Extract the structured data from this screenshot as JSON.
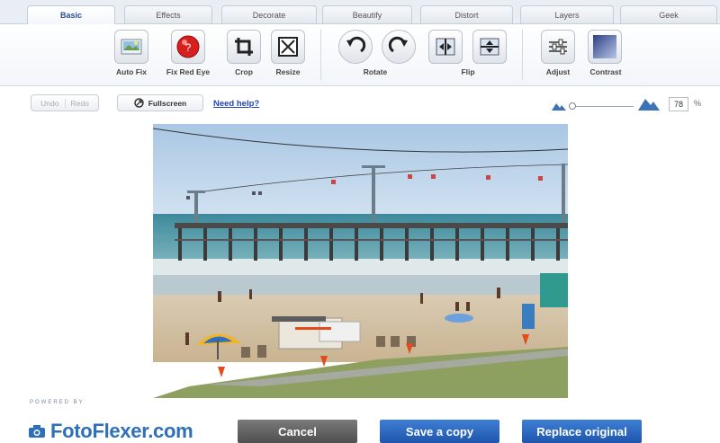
{
  "tabs": [
    {
      "label": "Basic",
      "active": true
    },
    {
      "label": "Effects",
      "active": false
    },
    {
      "label": "Decorate",
      "active": false
    },
    {
      "label": "Beautify",
      "active": false
    },
    {
      "label": "Distort",
      "active": false
    },
    {
      "label": "Layers",
      "active": false
    },
    {
      "label": "Geek",
      "active": false
    }
  ],
  "tools": {
    "auto_fix": "Auto Fix",
    "fix_red_eye": "Fix Red Eye",
    "crop": "Crop",
    "resize": "Resize",
    "rotate": "Rotate",
    "flip": "Flip",
    "adjust": "Adjust",
    "contrast": "Contrast"
  },
  "editbar": {
    "undo": "Undo",
    "redo": "Redo",
    "fullscreen": "Fullscreen",
    "help": "Need help?"
  },
  "zoom": {
    "value": "78",
    "unit": "%",
    "level_fraction": 0.0
  },
  "footer": {
    "powered_by": "POWERED BY",
    "brand": "FotoFlexer.com",
    "cancel": "Cancel",
    "save_copy": "Save a copy",
    "replace_original": "Replace original"
  },
  "colors": {
    "accent": "#2d6fb8",
    "button_blue": "#1f56ad",
    "link": "#2144b5"
  }
}
